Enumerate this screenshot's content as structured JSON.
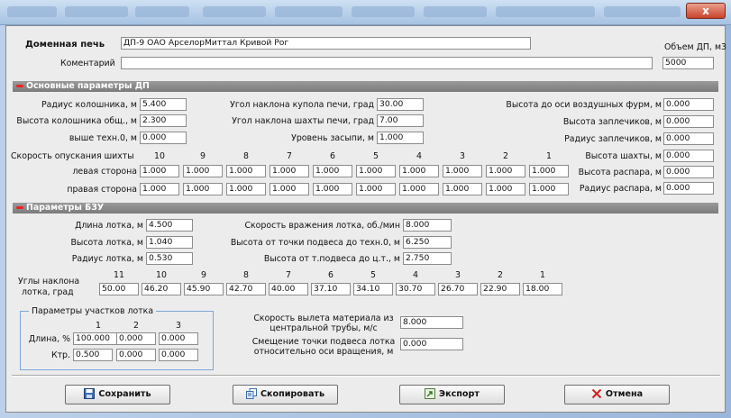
{
  "window": {
    "close_label": "x"
  },
  "header": {
    "furnace_label": "Доменная печь",
    "furnace_value": "ДП-9 ОАО АрселорМиттал Кривой Рог",
    "comment_label": "Коментарий",
    "comment_value": "",
    "volume_label": "Объем ДП, м3",
    "volume_value": "5000"
  },
  "section1": {
    "title": "Основные параметры ДП",
    "fields": [
      {
        "label": "Радиус колошника, м",
        "value": "5.400"
      },
      {
        "label": "Высота колошника общ., м",
        "value": "2.300"
      },
      {
        "label": "выше техн.0, м",
        "value": "0.000"
      },
      {
        "label": "Угол наклона купола печи, град",
        "value": "30.00"
      },
      {
        "label": "Угол наклона шахты печи, град",
        "value": "7.00"
      },
      {
        "label": "Уровень засыпи, м",
        "value": "1.000"
      },
      {
        "label": "Высота до оси воздушных фурм, м",
        "value": "0.000"
      },
      {
        "label": "Высота заплечиков, м",
        "value": "0.000"
      },
      {
        "label": "Радиус заплечиков, м",
        "value": "0.000"
      },
      {
        "label": "Высота шахты, м",
        "value": "0.000"
      },
      {
        "label": "Высота распара, м",
        "value": "0.000"
      },
      {
        "label": "Радиус распара, м",
        "value": "0.000"
      }
    ],
    "descent_label": "Скорость опускания шихты",
    "descent_columns": [
      "10",
      "9",
      "8",
      "7",
      "6",
      "5",
      "4",
      "3",
      "2",
      "1"
    ],
    "left_side_label": "левая сторона",
    "left_side_values": [
      "1.000",
      "1.000",
      "1.000",
      "1.000",
      "1.000",
      "1.000",
      "1.000",
      "1.000",
      "1.000",
      "1.000"
    ],
    "right_side_label": "правая сторона",
    "right_side_values": [
      "1.000",
      "1.000",
      "1.000",
      "1.000",
      "1.000",
      "1.000",
      "1.000",
      "1.000",
      "1.000",
      "1.000"
    ]
  },
  "section2": {
    "title": "Параметры БЗУ",
    "fields": [
      {
        "label": "Длина лотка, м",
        "value": "4.500"
      },
      {
        "label": "Высота лотка, м",
        "value": "1.040"
      },
      {
        "label": "Радиус лотка, м",
        "value": "0.530"
      },
      {
        "label": "Скорость вражения лотка, об./мин",
        "value": "8.000"
      },
      {
        "label": "Высота от точки подвеса до техн.0, м",
        "value": "6.250"
      },
      {
        "label": "Высота от т.подвеса до ц.т., м",
        "value": "2.750"
      }
    ],
    "angles_label_line1": "Углы наклона",
    "angles_label_line2": "лотка, град",
    "angle_columns": [
      "11",
      "10",
      "9",
      "8",
      "7",
      "6",
      "5",
      "4",
      "3",
      "2",
      "1"
    ],
    "angle_values": [
      "50.00",
      "46.20",
      "45.90",
      "42.70",
      "40.00",
      "37.10",
      "34.10",
      "30.70",
      "26.70",
      "22.90",
      "18.00"
    ],
    "sections_group_title": "Параметры участков лотка",
    "sections_columns": [
      "1",
      "2",
      "3"
    ],
    "length_label": "Длина, %",
    "length_values": [
      "100.000",
      "0.000",
      "0.000"
    ],
    "ktr_label": "Ктр.",
    "ktr_values": [
      "0.500",
      "0.000",
      "0.000"
    ],
    "material_speed_line1": "Скорость вылета материала из",
    "material_speed_line2": "центральной трубы, м/с",
    "material_speed_value": "8.000",
    "offset_line1": "Смещение точки подвеса лотка",
    "offset_line2": "относительно оси вращения, м",
    "offset_value": "0.000"
  },
  "buttons": {
    "save": "Сохранить",
    "copy": "Скопировать",
    "export": "Экспорт",
    "cancel": "Отмена"
  },
  "colors": {
    "section_bar": "#8a8a8a",
    "accent_red": "#e22222",
    "group_border": "#7aa7d6"
  }
}
